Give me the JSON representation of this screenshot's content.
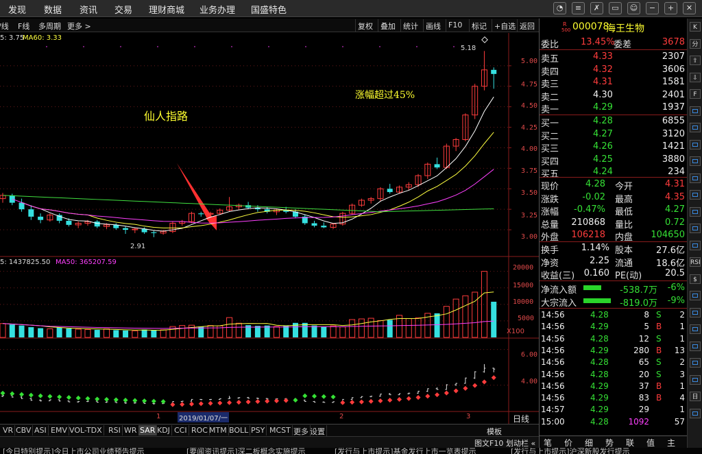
{
  "top_menu": [
    "发现",
    "数据",
    "资讯",
    "交易",
    "理财商城",
    "业务办理",
    "国盛特色"
  ],
  "top_icons": [
    "message-icon",
    "settings-icon",
    "tools-icon",
    "monitor-icon",
    "customer-service-icon",
    "minimize-icon",
    "maximize-icon",
    "close-icon"
  ],
  "chart_toolbar": {
    "left": [
      "/线",
      "F线",
      "多周期",
      "更多 >"
    ],
    "right": [
      "复权",
      "叠加",
      "统计",
      "画线",
      "F10",
      "标记",
      "+自选",
      "返回"
    ]
  },
  "ma_legend": {
    "ma5": "5: 3.75",
    "ma60": "MA60: 3.33"
  },
  "vol_legend": {
    "vol": "5: 1437825.50",
    "ma50": "MA50: 365207.59"
  },
  "annotations": {
    "pattern": "仙人指路",
    "rise": "涨幅超过45%",
    "high_label": "5.18",
    "low_label": "2.91",
    "date_label": "2019/01/07/一",
    "vol_unit": "X100",
    "period": "日线"
  },
  "month_marks": [
    "1",
    "2",
    "3"
  ],
  "price_axis": [
    "5.00",
    "4.75",
    "4.50",
    "4.25",
    "4.00",
    "3.75",
    "3.50",
    "3.25",
    "3.00"
  ],
  "vol_axis": [
    "20000",
    "15000",
    "10000",
    "5000"
  ],
  "sar_axis": [
    "6.00",
    "4.00"
  ],
  "indicator_tabs": [
    "VR",
    "CBV",
    "ASI",
    "EMV",
    "VOL-TDX",
    "RSI",
    "WR",
    "SAR",
    "KDJ",
    "CCI",
    "ROC",
    "MTM",
    "BOLL",
    "PSY",
    "MCST",
    "更多",
    "设置"
  ],
  "active_indicator": "SAR",
  "status_right": {
    "template": "模板",
    "f10": "图文F10",
    "scroll": "划动栏 «"
  },
  "right_tabs": [
    "笔",
    "价",
    "细",
    "势",
    "联",
    "值",
    "主"
  ],
  "news": [
    "[今日特别提示]今日上市公司业绩预告提示",
    "[要闻资讯提示]深二板概念实施提示",
    "[发行与上市提示]基金发行上市一览表提示",
    "[发行与上市提示]沪深新股发行提示"
  ],
  "stock": {
    "code": "000078",
    "name": "海王生物",
    "market": "R",
    "tag": "500"
  },
  "weibi": {
    "label": "委比",
    "value": "13.45%",
    "label2": "委差",
    "value2": "3678"
  },
  "sell_orders": [
    {
      "label": "卖五",
      "price": "4.33",
      "vol": "2307"
    },
    {
      "label": "卖四",
      "price": "4.32",
      "vol": "3606"
    },
    {
      "label": "卖三",
      "price": "4.31",
      "vol": "1581"
    },
    {
      "label": "卖二",
      "price": "4.30",
      "vol": "2401"
    },
    {
      "label": "卖一",
      "price": "4.29",
      "vol": "1937"
    }
  ],
  "buy_orders": [
    {
      "label": "买一",
      "price": "4.28",
      "vol": "6855"
    },
    {
      "label": "买二",
      "price": "4.27",
      "vol": "3120"
    },
    {
      "label": "买三",
      "price": "4.26",
      "vol": "1421"
    },
    {
      "label": "买四",
      "price": "4.25",
      "vol": "3880"
    },
    {
      "label": "买五",
      "price": "4.24",
      "vol": "234"
    }
  ],
  "quote_rows": [
    {
      "l1": "现价",
      "v1": "4.28",
      "c1": "green",
      "l2": "今开",
      "v2": "4.31",
      "c2": "red"
    },
    {
      "l1": "涨跌",
      "v1": "-0.02",
      "c1": "green",
      "l2": "最高",
      "v2": "4.35",
      "c2": "red"
    },
    {
      "l1": "涨幅",
      "v1": "-0.47%",
      "c1": "green",
      "l2": "最低",
      "v2": "4.27",
      "c2": "green"
    },
    {
      "l1": "总量",
      "v1": "210868",
      "c1": "white",
      "l2": "量比",
      "v2": "0.72",
      "c2": "green"
    },
    {
      "l1": "外盘",
      "v1": "106218",
      "c1": "red",
      "l2": "内盘",
      "v2": "104650",
      "c2": "green"
    }
  ],
  "fund_rows": [
    {
      "l1": "换手",
      "v1": "1.14%",
      "l2": "股本",
      "v2": "27.6亿"
    },
    {
      "l1": "净资",
      "v1": "2.25",
      "l2": "流通",
      "v2": "18.6亿"
    },
    {
      "l1": "收益(三)",
      "v1": "0.160",
      "l2": "PE(动)",
      "v2": "20.5"
    }
  ],
  "flows": [
    {
      "label": "净流入额",
      "value": "-538.7万",
      "pct": "-6%"
    },
    {
      "label": "大宗流入",
      "value": "-819.0万",
      "pct": "-9%"
    }
  ],
  "ticks": [
    {
      "time": "14:56",
      "price": "4.28",
      "vol": "8",
      "bs": "S",
      "n": "2"
    },
    {
      "time": "14:56",
      "price": "4.29",
      "vol": "5",
      "bs": "B",
      "n": "1"
    },
    {
      "time": "14:56",
      "price": "4.28",
      "vol": "12",
      "bs": "S",
      "n": "1"
    },
    {
      "time": "14:56",
      "price": "4.29",
      "vol": "280",
      "bs": "B",
      "n": "13"
    },
    {
      "time": "14:56",
      "price": "4.28",
      "vol": "65",
      "bs": "S",
      "n": "2"
    },
    {
      "time": "14:56",
      "price": "4.28",
      "vol": "20",
      "bs": "S",
      "n": "3"
    },
    {
      "time": "14:56",
      "price": "4.29",
      "vol": "37",
      "bs": "B",
      "n": "1"
    },
    {
      "time": "14:56",
      "price": "4.29",
      "vol": "83",
      "bs": "B",
      "n": "4"
    },
    {
      "time": "14:57",
      "price": "4.29",
      "vol": "29",
      "bs": "",
      "n": "1"
    },
    {
      "time": "15:00",
      "price": "4.28",
      "vol": "1092",
      "bs": "",
      "n": "57"
    }
  ],
  "side_icons": [
    "K",
    "分",
    "⇧",
    "⇩",
    "F",
    "",
    "",
    "",
    "",
    "",
    "",
    "",
    "",
    "",
    "RSI",
    "$",
    "",
    "",
    "",
    "",
    "",
    "",
    "日",
    ""
  ],
  "colors": {
    "up": "#ff3c3c",
    "down": "#35e0e0",
    "ma5": "#ffffff",
    "ma10": "#ffff40",
    "ma20": "#ff40ff",
    "ma60": "#40e040"
  },
  "chart_data": {
    "type": "candlestick",
    "y_price_range": [
      2.85,
      5.3
    ],
    "candles": [
      [
        3.38,
        3.45,
        3.33,
        3.42
      ],
      [
        3.42,
        3.44,
        3.3,
        3.33
      ],
      [
        3.33,
        3.38,
        3.22,
        3.25
      ],
      [
        3.25,
        3.3,
        3.12,
        3.16
      ],
      [
        3.16,
        3.2,
        3.08,
        3.12
      ],
      [
        3.12,
        3.2,
        3.1,
        3.18
      ],
      [
        3.18,
        3.2,
        3.08,
        3.11
      ],
      [
        3.11,
        3.14,
        3.04,
        3.06
      ],
      [
        3.06,
        3.1,
        3.02,
        3.08
      ],
      [
        3.08,
        3.12,
        3.05,
        3.1
      ],
      [
        3.1,
        3.12,
        3.02,
        3.04
      ],
      [
        3.04,
        3.08,
        3.01,
        3.06
      ],
      [
        3.06,
        3.08,
        3.0,
        3.02
      ],
      [
        3.02,
        3.04,
        2.95,
        3.0
      ],
      [
        3.0,
        3.03,
        2.96,
        3.01
      ],
      [
        3.01,
        3.03,
        2.95,
        2.97
      ],
      [
        2.97,
        2.99,
        2.91,
        2.96
      ],
      [
        2.96,
        3.0,
        2.94,
        2.98
      ],
      [
        2.98,
        3.1,
        2.96,
        3.08
      ],
      [
        3.08,
        3.12,
        3.05,
        3.1
      ],
      [
        3.1,
        3.22,
        3.08,
        3.2
      ],
      [
        3.2,
        3.22,
        3.16,
        3.19
      ],
      [
        3.19,
        3.22,
        3.16,
        3.2
      ],
      [
        3.2,
        3.26,
        3.18,
        3.24
      ],
      [
        3.24,
        3.4,
        3.22,
        3.28
      ],
      [
        3.28,
        3.32,
        3.24,
        3.3
      ],
      [
        3.3,
        3.34,
        3.25,
        3.27
      ],
      [
        3.27,
        3.3,
        3.22,
        3.25
      ],
      [
        3.25,
        3.28,
        3.2,
        3.22
      ],
      [
        3.22,
        3.26,
        3.18,
        3.24
      ],
      [
        3.24,
        3.28,
        3.2,
        3.22
      ],
      [
        3.22,
        3.25,
        3.14,
        3.16
      ],
      [
        3.16,
        3.19,
        3.06,
        3.08
      ],
      [
        3.08,
        3.11,
        3.03,
        3.05
      ],
      [
        3.05,
        3.09,
        3.02,
        3.03
      ],
      [
        3.03,
        3.08,
        3.01,
        3.07
      ],
      [
        3.07,
        3.22,
        3.05,
        3.2
      ],
      [
        3.2,
        3.32,
        3.18,
        3.3
      ],
      [
        3.3,
        3.38,
        3.28,
        3.36
      ],
      [
        3.36,
        3.4,
        3.32,
        3.38
      ],
      [
        3.38,
        3.52,
        3.35,
        3.5
      ],
      [
        3.5,
        3.56,
        3.44,
        3.46
      ],
      [
        3.46,
        3.54,
        3.44,
        3.52
      ],
      [
        3.52,
        3.58,
        3.48,
        3.55
      ],
      [
        3.55,
        3.68,
        3.52,
        3.66
      ],
      [
        3.66,
        3.82,
        3.62,
        3.8
      ],
      [
        3.8,
        3.88,
        3.74,
        3.76
      ],
      [
        3.76,
        4.05,
        3.74,
        4.02
      ],
      [
        4.02,
        4.12,
        3.96,
        4.1
      ],
      [
        4.1,
        4.42,
        4.08,
        4.4
      ],
      [
        4.4,
        4.78,
        4.35,
        4.75
      ],
      [
        4.75,
        5.18,
        4.7,
        4.95
      ],
      [
        4.95,
        4.98,
        4.72,
        4.9
      ]
    ],
    "volumes": [
      4200,
      3900,
      3600,
      3100,
      2800,
      2600,
      3000,
      2700,
      2500,
      2400,
      2300,
      2600,
      2200,
      2100,
      2000,
      2400,
      2200,
      2300,
      3300,
      3600,
      3700,
      3300,
      3600,
      3500,
      6000,
      4300,
      3700,
      3500,
      3600,
      3300,
      3600,
      4400,
      4400,
      3600,
      3300,
      3500,
      3200,
      5400,
      5600,
      5800,
      5100,
      5300,
      6700,
      5700,
      5900,
      7300,
      7300,
      9400,
      11600,
      12600,
      13700,
      20000,
      10800
    ],
    "vol_range": [
      0,
      22000
    ],
    "sar": [
      3.55,
      3.52,
      3.48,
      3.44,
      3.4,
      3.37,
      3.34,
      3.31,
      3.28,
      3.25,
      3.22,
      3.2,
      3.18,
      3.16,
      3.14,
      3.12,
      3.1,
      3.08,
      2.91,
      2.92,
      2.94,
      2.96,
      2.98,
      3.0,
      3.02,
      3.04,
      3.06,
      3.08,
      3.1,
      3.12,
      3.14,
      3.16,
      3.4,
      3.38,
      3.36,
      3.34,
      3.02,
      3.04,
      3.06,
      3.09,
      3.12,
      3.16,
      3.2,
      3.25,
      3.31,
      3.38,
      3.46,
      3.56,
      3.68,
      3.82,
      3.98,
      4.18,
      4.42
    ],
    "sar_range": [
      2.6,
      6.6
    ]
  }
}
